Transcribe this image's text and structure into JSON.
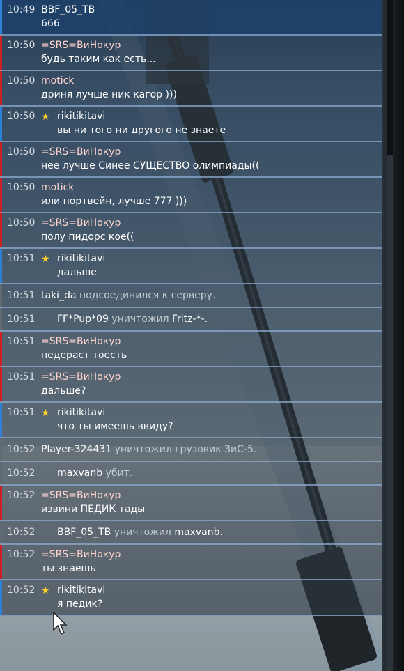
{
  "chat": {
    "messages": [
      {
        "kind": "msg",
        "time": "10:49",
        "sender": "BBF_05_TB",
        "text": "666",
        "bar": "blue",
        "star": false,
        "top": true
      },
      {
        "kind": "msg",
        "time": "10:50",
        "sender": "=SRS=ВиНокур",
        "text": "будь таким как есть...",
        "bar": "red",
        "star": false
      },
      {
        "kind": "msg",
        "time": "10:50",
        "sender": "motick",
        "text": "дриня лучше ник кагор )))",
        "bar": "red",
        "star": false
      },
      {
        "kind": "msg",
        "time": "10:50",
        "sender": "rikitikitavi",
        "text": "вы ни того ни другого не знаете",
        "bar": "blue",
        "star": true
      },
      {
        "kind": "msg",
        "time": "10:50",
        "sender": "=SRS=ВиНокур",
        "text": "нее лучше Синее СУЩЕСТВО олимпиады((",
        "bar": "red",
        "star": false
      },
      {
        "kind": "msg",
        "time": "10:50",
        "sender": "motick",
        "text": "или портвейн, лучше 777 )))",
        "bar": "red",
        "star": false
      },
      {
        "kind": "msg",
        "time": "10:50",
        "sender": "=SRS=ВиНокур",
        "text": "полу пидорс кое((",
        "bar": "red",
        "star": false
      },
      {
        "kind": "msg",
        "time": "10:51",
        "sender": "rikitikitavi",
        "text": "дальше",
        "bar": "blue",
        "star": true
      },
      {
        "kind": "event",
        "time": "10:51",
        "actor": "taki_da",
        "verb": "подсоединился к серверу.",
        "target": "",
        "indent": false
      },
      {
        "kind": "event",
        "time": "10:51",
        "actor": "FF*Pup*09",
        "verb": "уничтожил",
        "target": "Fritz-*-.",
        "indent": true
      },
      {
        "kind": "msg",
        "time": "10:51",
        "sender": "=SRS=ВиНокур",
        "text": "педераст тоесть",
        "bar": "red",
        "star": false
      },
      {
        "kind": "msg",
        "time": "10:51",
        "sender": "=SRS=ВиНокур",
        "text": "дальше?",
        "bar": "red",
        "star": false
      },
      {
        "kind": "msg",
        "time": "10:51",
        "sender": "rikitikitavi",
        "text": "что ты имеешь ввиду?",
        "bar": "blue",
        "star": true
      },
      {
        "kind": "event",
        "time": "10:52",
        "actor": "Player-324431",
        "verb": "уничтожил грузовик ЗиС-5.",
        "target": "",
        "indent": false
      },
      {
        "kind": "event",
        "time": "10:52",
        "actor": "maxvanb",
        "verb": "убит.",
        "target": "",
        "indent": true
      },
      {
        "kind": "msg",
        "time": "10:52",
        "sender": "=SRS=ВиНокур",
        "text": "извини ПЕДИК тады",
        "bar": "red",
        "star": false
      },
      {
        "kind": "event",
        "time": "10:52",
        "actor": "BBF_05_TB",
        "verb": "уничтожил",
        "target": "maxvanb.",
        "indent": true
      },
      {
        "kind": "msg",
        "time": "10:52",
        "sender": "=SRS=ВиНокур",
        "text": "ты знаешь",
        "bar": "red",
        "star": false
      },
      {
        "kind": "msg",
        "time": "10:52",
        "sender": "rikitikitavi",
        "text": "я педик?",
        "bar": "blue",
        "star": true
      }
    ]
  },
  "icons": {
    "star": "star-icon",
    "cursor": "mouse-cursor-icon"
  },
  "colors": {
    "enemy_bar": "#cc1f26",
    "ally_bar": "#2f7fd6",
    "star": "#ffd22a",
    "enemy_name": "#ffd4cf"
  }
}
